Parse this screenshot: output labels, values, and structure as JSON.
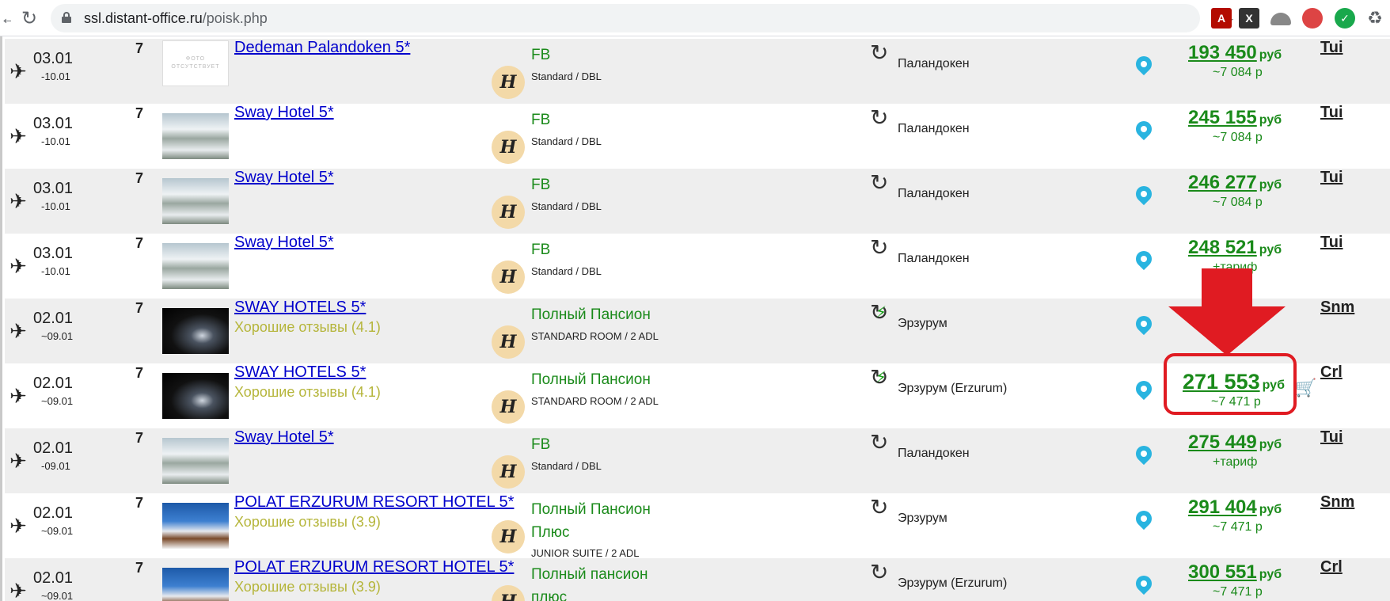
{
  "browser": {
    "url_host": "ssl.distant-office.ru",
    "url_path": "/poisk.php",
    "extensions": [
      "pdf-extension-icon",
      "x-extension-icon",
      "hat-extension-icon",
      "pin-extension-icon",
      "leaf-extension-icon",
      "puzzle-extensions-icon"
    ]
  },
  "colors": {
    "link": "#0000cc",
    "meal_green": "#1a8a1a",
    "review_olive": "#b5b53a",
    "annotation_red": "#e01b22",
    "pin_blue": "#29b4e0"
  },
  "rows": [
    {
      "date": "03.01",
      "date_end": "-10.01",
      "nights": "7",
      "thumb": "nophoto",
      "nophoto_text": "ФОТО ОТСУТСТВУЕТ",
      "hotel": "Dedeman Palandoken 5*",
      "review": "",
      "meal": "FB",
      "meal2": "",
      "room": "Standard / DBL",
      "sync": "normal",
      "city": "Паландокен",
      "price": "193 450",
      "currency": "руб",
      "price_sub": "~7 084 р",
      "operator": "Tui"
    },
    {
      "date": "03.01",
      "date_end": "-10.01",
      "nights": "7",
      "thumb": "snow",
      "hotel": "Sway Hotel 5*",
      "review": "",
      "meal": "FB",
      "meal2": "",
      "room": "Standard / DBL",
      "sync": "normal",
      "city": "Паландокен",
      "price": "245 155",
      "currency": "руб",
      "price_sub": "~7 084 р",
      "operator": "Tui"
    },
    {
      "date": "03.01",
      "date_end": "-10.01",
      "nights": "7",
      "thumb": "snow",
      "hotel": "Sway Hotel 5*",
      "review": "",
      "meal": "FB",
      "meal2": "",
      "room": "Standard / DBL",
      "sync": "normal",
      "city": "Паландокен",
      "price": "246 277",
      "currency": "руб",
      "price_sub": "~7 084 р",
      "operator": "Tui"
    },
    {
      "date": "03.01",
      "date_end": "-10.01",
      "nights": "7",
      "thumb": "snow",
      "hotel": "Sway Hotel 5*",
      "review": "",
      "meal": "FB",
      "meal2": "",
      "room": "Standard / DBL",
      "sync": "normal",
      "city": "Паландокен",
      "price": "248 521",
      "currency": "руб",
      "price_sub": "+тариф",
      "operator": "Tui"
    },
    {
      "date": "02.01",
      "date_end": "~09.01",
      "nights": "7",
      "thumb": "night",
      "hotel": "SWAY HOTELS 5*",
      "review": "Хорошие отзывы (4.1)",
      "meal": "Полный Пансион",
      "meal2": "",
      "room": "STANDARD ROOM / 2 ADL",
      "sync": "green",
      "city": "Эрзурум",
      "price": "",
      "currency": "",
      "price_sub": "",
      "operator": "Snm"
    },
    {
      "date": "02.01",
      "date_end": "~09.01",
      "nights": "7",
      "thumb": "night",
      "hotel": "SWAY HOTELS 5*",
      "review": "Хорошие отзывы (4.1)",
      "meal": "Полный Пансион",
      "meal2": "",
      "room": "STANDARD ROOM / 2 ADL",
      "sync": "green",
      "city": "Эрзурум (Erzurum)",
      "price": "271 553",
      "currency": "руб",
      "price_sub": "~7 471 р",
      "operator": "Crl",
      "highlight": true
    },
    {
      "date": "02.01",
      "date_end": "-09.01",
      "nights": "7",
      "thumb": "snow",
      "hotel": "Sway Hotel 5*",
      "review": "",
      "meal": "FB",
      "meal2": "",
      "room": "Standard / DBL",
      "sync": "normal",
      "city": "Паландокен",
      "price": "275 449",
      "currency": "руб",
      "price_sub": "+тариф",
      "operator": "Tui"
    },
    {
      "date": "02.01",
      "date_end": "~09.01",
      "nights": "7",
      "thumb": "resort",
      "hotel": "POLAT ERZURUM RESORT HOTEL 5*",
      "review": "Хорошие отзывы (3.9)",
      "meal": "Полный Пансион",
      "meal2": "Плюс",
      "room": "JUNIOR SUITE / 2 ADL",
      "sync": "normal",
      "city": "Эрзурум",
      "price": "291 404",
      "currency": "руб",
      "price_sub": "~7 471 р",
      "operator": "Snm"
    },
    {
      "date": "02.01",
      "date_end": "~09.01",
      "nights": "7",
      "thumb": "resort",
      "hotel": "POLAT ERZURUM RESORT HOTEL 5*",
      "review": "Хорошие отзывы (3.9)",
      "meal": "Полный пансион",
      "meal2": "плюс",
      "room": "",
      "sync": "normal",
      "city": "Эрзурум (Erzurum)",
      "price": "300 551",
      "currency": "руб",
      "price_sub": "~7 471 р",
      "operator": "Crl"
    }
  ]
}
